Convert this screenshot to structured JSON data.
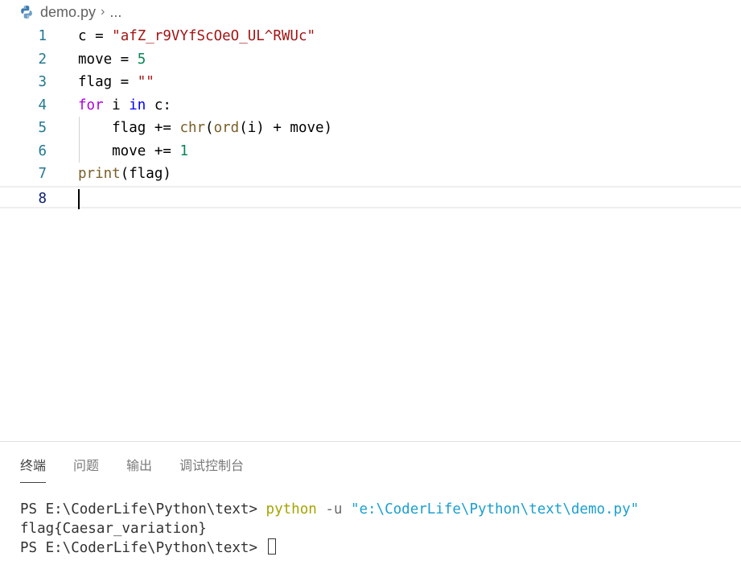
{
  "breadcrumb": {
    "file": "demo.py",
    "more": "..."
  },
  "editor": {
    "lines": [
      {
        "num": "1",
        "tokens": [
          [
            "plain",
            "c = "
          ],
          [
            "str",
            "\"afZ_r9VYfScOeO_UL^RWUc\""
          ]
        ]
      },
      {
        "num": "2",
        "tokens": [
          [
            "plain",
            "move = "
          ],
          [
            "num",
            "5"
          ]
        ]
      },
      {
        "num": "3",
        "tokens": [
          [
            "plain",
            "flag = "
          ],
          [
            "str",
            "\"\""
          ]
        ]
      },
      {
        "num": "4",
        "tokens": [
          [
            "kw",
            "for"
          ],
          [
            "plain",
            " i "
          ],
          [
            "kw2",
            "in"
          ],
          [
            "plain",
            " c:"
          ]
        ]
      },
      {
        "num": "5",
        "tokens": [
          [
            "plain",
            "    flag += "
          ],
          [
            "fn",
            "chr"
          ],
          [
            "plain",
            "("
          ],
          [
            "fn",
            "ord"
          ],
          [
            "plain",
            "(i) + move)"
          ]
        ]
      },
      {
        "num": "6",
        "tokens": [
          [
            "plain",
            "    move += "
          ],
          [
            "num",
            "1"
          ]
        ]
      },
      {
        "num": "7",
        "tokens": [
          [
            "fn",
            "print"
          ],
          [
            "plain",
            "(flag)"
          ]
        ]
      },
      {
        "num": "8",
        "tokens": []
      }
    ]
  },
  "panel": {
    "tabs": [
      "终端",
      "问题",
      "输出",
      "调试控制台"
    ],
    "active_tab": 0
  },
  "terminal": {
    "prompt": "PS E:\\CoderLife\\Python\\text> ",
    "command": "python",
    "arg": "-u",
    "path": "\"e:\\CoderLife\\Python\\text\\demo.py\"",
    "output": "flag{Caesar_variation}",
    "prompt2": "PS E:\\CoderLife\\Python\\text> "
  }
}
